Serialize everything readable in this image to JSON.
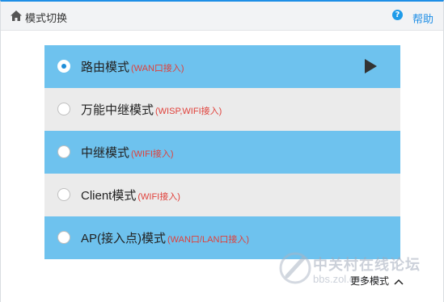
{
  "header": {
    "title": "模式切换",
    "help_label": "帮助",
    "help_glyph": "?"
  },
  "modes": [
    {
      "name": "路由模式",
      "note": "(WAN口接入)",
      "selected": true,
      "color": "#6ec2ee"
    },
    {
      "name": "万能中继模式",
      "note": "(WISP,WIFI接入)",
      "selected": false,
      "color": "#ebebeb"
    },
    {
      "name": "中继模式",
      "note": "(WIFI接入)",
      "selected": false,
      "color": "#6ec2ee"
    },
    {
      "name": "Client模式",
      "note": "(WIFI接入)",
      "selected": false,
      "color": "#ebebeb"
    },
    {
      "name": "AP(接入点)模式",
      "note": "(WAN口/LAN口接入)",
      "selected": false,
      "color": "#6ec2ee"
    }
  ],
  "footer": {
    "more_modes": "更多模式"
  },
  "watermark": {
    "name": "中关村在线论坛",
    "url": "bbs.zol.com.cn"
  },
  "colors": {
    "accent": "#1e8ee6",
    "row_blue": "#6ec2ee",
    "row_gray": "#ebebeb",
    "note_red": "#e0403a"
  },
  "icons": [
    "home-icon",
    "help-icon",
    "play-icon",
    "chevron-up-icon",
    "radio-icon"
  ]
}
